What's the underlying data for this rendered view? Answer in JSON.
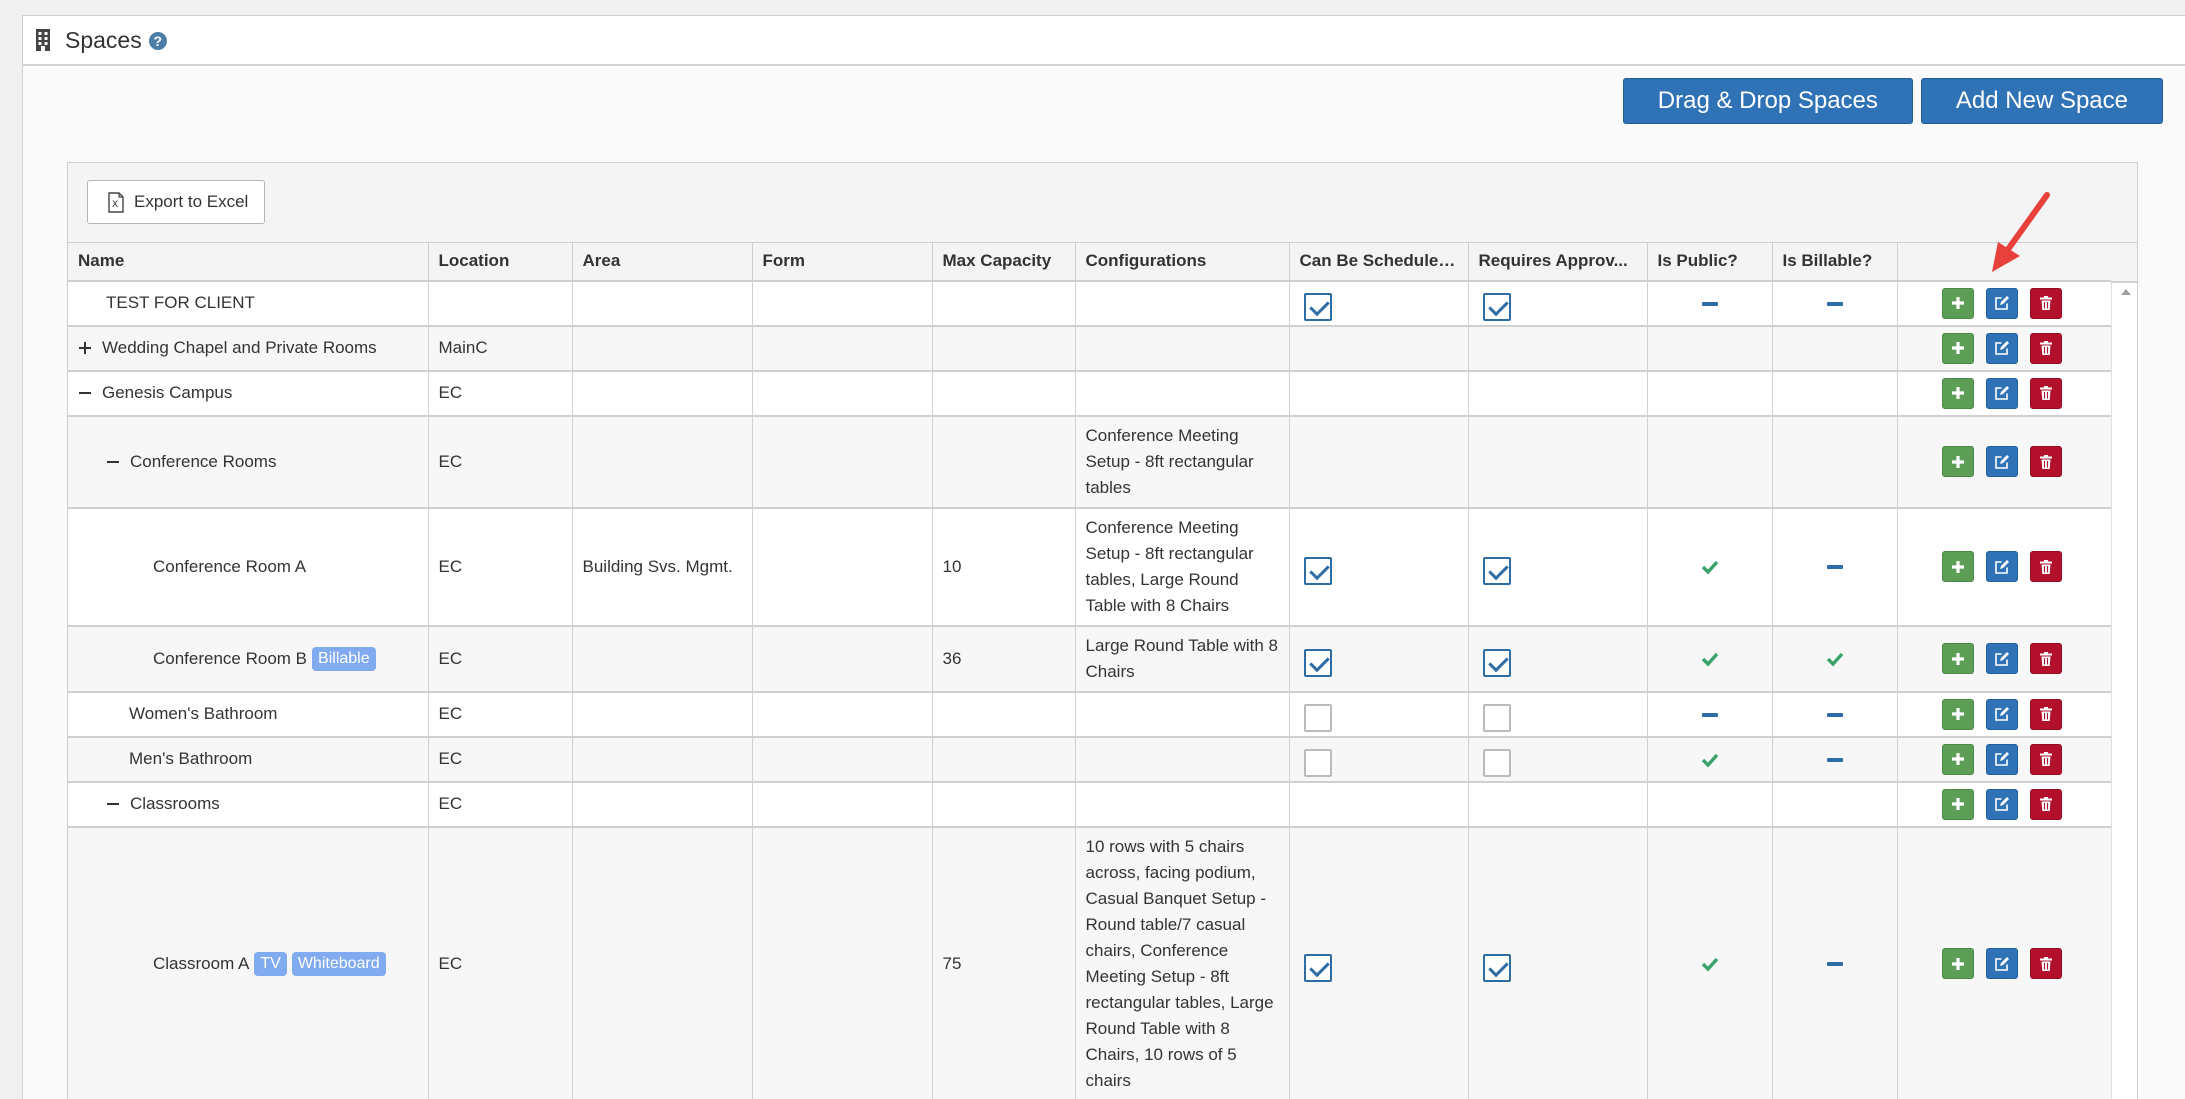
{
  "header": {
    "title": "Spaces",
    "help_glyph": "?"
  },
  "toolbar": {
    "drag_drop_label": "Drag & Drop Spaces",
    "add_new_label": "Add New Space"
  },
  "grid": {
    "export_label": "Export to Excel",
    "columns": [
      "Name",
      "Location",
      "Area",
      "Form",
      "Max Capacity",
      "Configurations",
      "Can Be Scheduled?",
      "Requires Approv...",
      "Is Public?",
      "Is Billable?"
    ],
    "rows": [
      {
        "name": "TEST FOR CLIENT",
        "indent": 1,
        "toggle": "none",
        "badges": [],
        "location": "",
        "area": "",
        "form": "",
        "capacity": "",
        "configurations": "",
        "scheduled": "checked",
        "approval": "checked",
        "public": "dash",
        "billable": "dash"
      },
      {
        "name": "Wedding Chapel and Private Rooms",
        "indent": 0,
        "toggle": "plus",
        "badges": [],
        "location": "MainC",
        "area": "",
        "form": "",
        "capacity": "",
        "configurations": "",
        "scheduled": "none",
        "approval": "none",
        "public": "none",
        "billable": "none"
      },
      {
        "name": "Genesis Campus",
        "indent": 0,
        "toggle": "minus",
        "badges": [],
        "location": "EC",
        "area": "",
        "form": "",
        "capacity": "",
        "configurations": "",
        "scheduled": "none",
        "approval": "none",
        "public": "none",
        "billable": "none"
      },
      {
        "name": "Conference Rooms",
        "indent": 1,
        "toggle": "minus",
        "badges": [],
        "location": "EC",
        "area": "",
        "form": "",
        "capacity": "",
        "configurations": "Conference Meeting Setup - 8ft rectangular tables",
        "scheduled": "none",
        "approval": "none",
        "public": "none",
        "billable": "none"
      },
      {
        "name": "Conference Room A",
        "indent": 3,
        "toggle": "none",
        "badges": [],
        "location": "EC",
        "area": "Building Svs. Mgmt.",
        "form": "",
        "capacity": "10",
        "configurations": "Conference Meeting Setup - 8ft rectangular tables, Large Round Table with 8 Chairs",
        "scheduled": "checked",
        "approval": "checked",
        "public": "tick",
        "billable": "dash"
      },
      {
        "name": "Conference Room B",
        "indent": 3,
        "toggle": "none",
        "badges": [
          "Billable"
        ],
        "location": "EC",
        "area": "",
        "form": "",
        "capacity": "36",
        "configurations": "Large Round Table with 8 Chairs",
        "scheduled": "checked",
        "approval": "checked",
        "public": "tick",
        "billable": "tick"
      },
      {
        "name": "Women's Bathroom",
        "indent": 2,
        "toggle": "none",
        "badges": [],
        "location": "EC",
        "area": "",
        "form": "",
        "capacity": "",
        "configurations": "",
        "scheduled": "unchecked",
        "approval": "unchecked",
        "public": "dash",
        "billable": "dash"
      },
      {
        "name": "Men's Bathroom",
        "indent": 2,
        "toggle": "none",
        "badges": [],
        "location": "EC",
        "area": "",
        "form": "",
        "capacity": "",
        "configurations": "",
        "scheduled": "unchecked",
        "approval": "unchecked",
        "public": "tick",
        "billable": "dash"
      },
      {
        "name": "Classrooms",
        "indent": 1,
        "toggle": "minus",
        "badges": [],
        "location": "EC",
        "area": "",
        "form": "",
        "capacity": "",
        "configurations": "",
        "scheduled": "none",
        "approval": "none",
        "public": "none",
        "billable": "none"
      },
      {
        "name": "Classroom A",
        "indent": 3,
        "toggle": "none",
        "badges": [
          "TV",
          "Whiteboard"
        ],
        "location": "EC",
        "area": "",
        "form": "",
        "capacity": "75",
        "configurations": "10 rows with 5 chairs across, facing podium, Casual Banquet Setup - Round table/7 casual chairs, Conference Meeting Setup - 8ft rectangular tables, Large Round Table with 8 Chairs, 10 rows of 5 chairs",
        "scheduled": "checked",
        "approval": "checked",
        "public": "tick",
        "billable": "dash"
      }
    ]
  },
  "colors": {
    "primary": "#2f72b6",
    "add": "#5c9e55",
    "delete": "#b3102c",
    "badge": "#80abf0",
    "tick": "#3aa36a",
    "arrow": "#e8403a"
  },
  "icons": {
    "header": "building-icon",
    "export": "excel-icon",
    "add": "plus-icon",
    "edit": "edit-icon",
    "delete": "trash-icon"
  }
}
